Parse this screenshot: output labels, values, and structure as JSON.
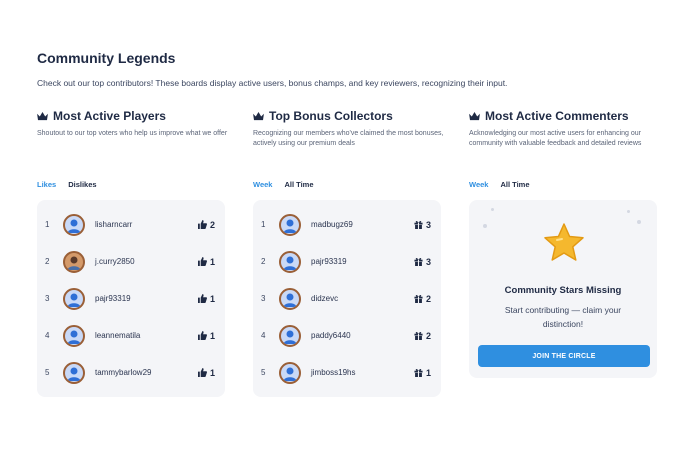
{
  "page": {
    "title": "Community Legends",
    "subtitle": "Check out our top contributors! These boards display active users, bonus champs, and key reviewers, recognizing their input."
  },
  "colors": {
    "accent": "#2f8fe0",
    "text": "#1f2a44",
    "card_bg": "#f4f5f8",
    "star": "#f5b82e"
  },
  "boards": [
    {
      "title": "Most Active Players",
      "description": "Shoutout to our top voters who help us improve what we offer",
      "tabs": [
        {
          "label": "Likes",
          "active": true
        },
        {
          "label": "Dislikes",
          "active": false
        }
      ],
      "score_icon": "thumbs-up-icon",
      "rows": [
        {
          "rank": "1",
          "username": "lisharncarr",
          "score": "2"
        },
        {
          "rank": "2",
          "username": "j.curry2850",
          "score": "1"
        },
        {
          "rank": "3",
          "username": "pajr93319",
          "score": "1"
        },
        {
          "rank": "4",
          "username": "leannematila",
          "score": "1"
        },
        {
          "rank": "5",
          "username": "tammybarlow29",
          "score": "1"
        }
      ]
    },
    {
      "title": "Top Bonus Collectors",
      "description": "Recognizing our members who've claimed the most bonuses, actively using our premium deals",
      "tabs": [
        {
          "label": "Week",
          "active": true
        },
        {
          "label": "All Time",
          "active": false
        }
      ],
      "score_icon": "gift-icon",
      "rows": [
        {
          "rank": "1",
          "username": "madbugz69",
          "score": "3"
        },
        {
          "rank": "2",
          "username": "pajr93319",
          "score": "3"
        },
        {
          "rank": "3",
          "username": "didzevc",
          "score": "2"
        },
        {
          "rank": "4",
          "username": "paddy6440",
          "score": "2"
        },
        {
          "rank": "5",
          "username": "jimboss19hs",
          "score": "1"
        }
      ]
    },
    {
      "title": "Most Active Commenters",
      "description": "Acknowledging our most active users for enhancing our community with valuable feedback and detailed reviews",
      "tabs": [
        {
          "label": "Week",
          "active": true
        },
        {
          "label": "All Time",
          "active": false
        }
      ],
      "empty_state": {
        "icon": "star-icon",
        "title": "Community Stars Missing",
        "text": "Start contributing — claim your distinction!",
        "button_label": "JOIN THE CIRCLE"
      }
    }
  ]
}
